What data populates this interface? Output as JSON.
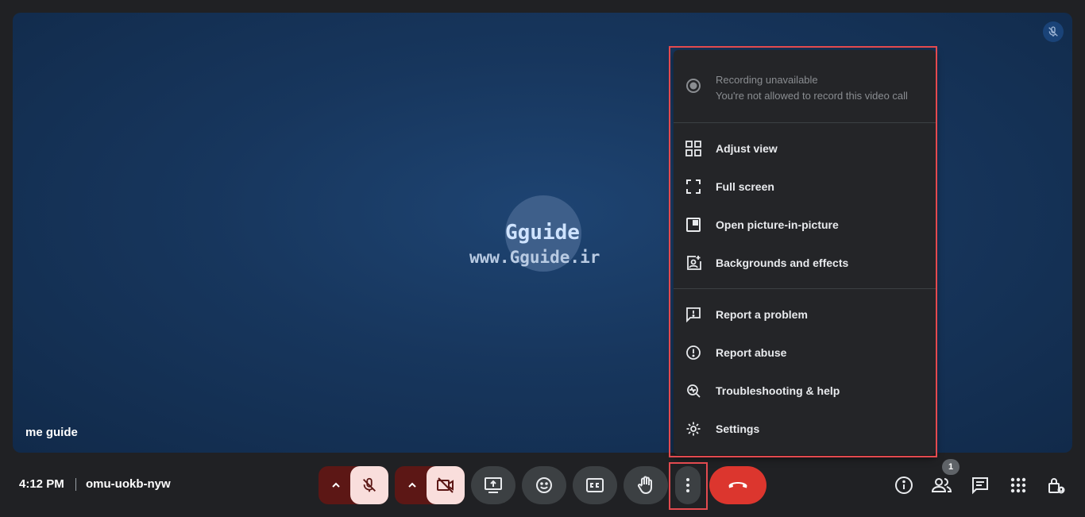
{
  "stage": {
    "participant_name": "me guide",
    "watermark_title": "Gguide",
    "watermark_url": "www.Gguide.ir"
  },
  "menu": {
    "recording": {
      "title": "Recording unavailable",
      "subtitle": "You're not allowed to record this video call"
    },
    "items": [
      {
        "label": "Adjust view",
        "icon": "adjust-view-icon"
      },
      {
        "label": "Full screen",
        "icon": "fullscreen-icon"
      },
      {
        "label": "Open picture-in-picture",
        "icon": "picture-in-picture-icon"
      },
      {
        "label": "Backgrounds and effects",
        "icon": "backgrounds-effects-icon"
      },
      {
        "label": "Report a problem",
        "icon": "report-problem-icon"
      },
      {
        "label": "Report abuse",
        "icon": "report-abuse-icon"
      },
      {
        "label": "Troubleshooting & help",
        "icon": "troubleshooting-icon"
      },
      {
        "label": "Settings",
        "icon": "settings-gear-icon"
      }
    ]
  },
  "bottom_bar": {
    "time": "4:12 PM",
    "meeting_code": "omu-uokb-nyw",
    "people_count": "1"
  },
  "colors": {
    "end_call": "#dc362e",
    "highlight": "#e34a4f",
    "control_off_bg": "#f9dedc",
    "stage_bg": "#17365d"
  }
}
